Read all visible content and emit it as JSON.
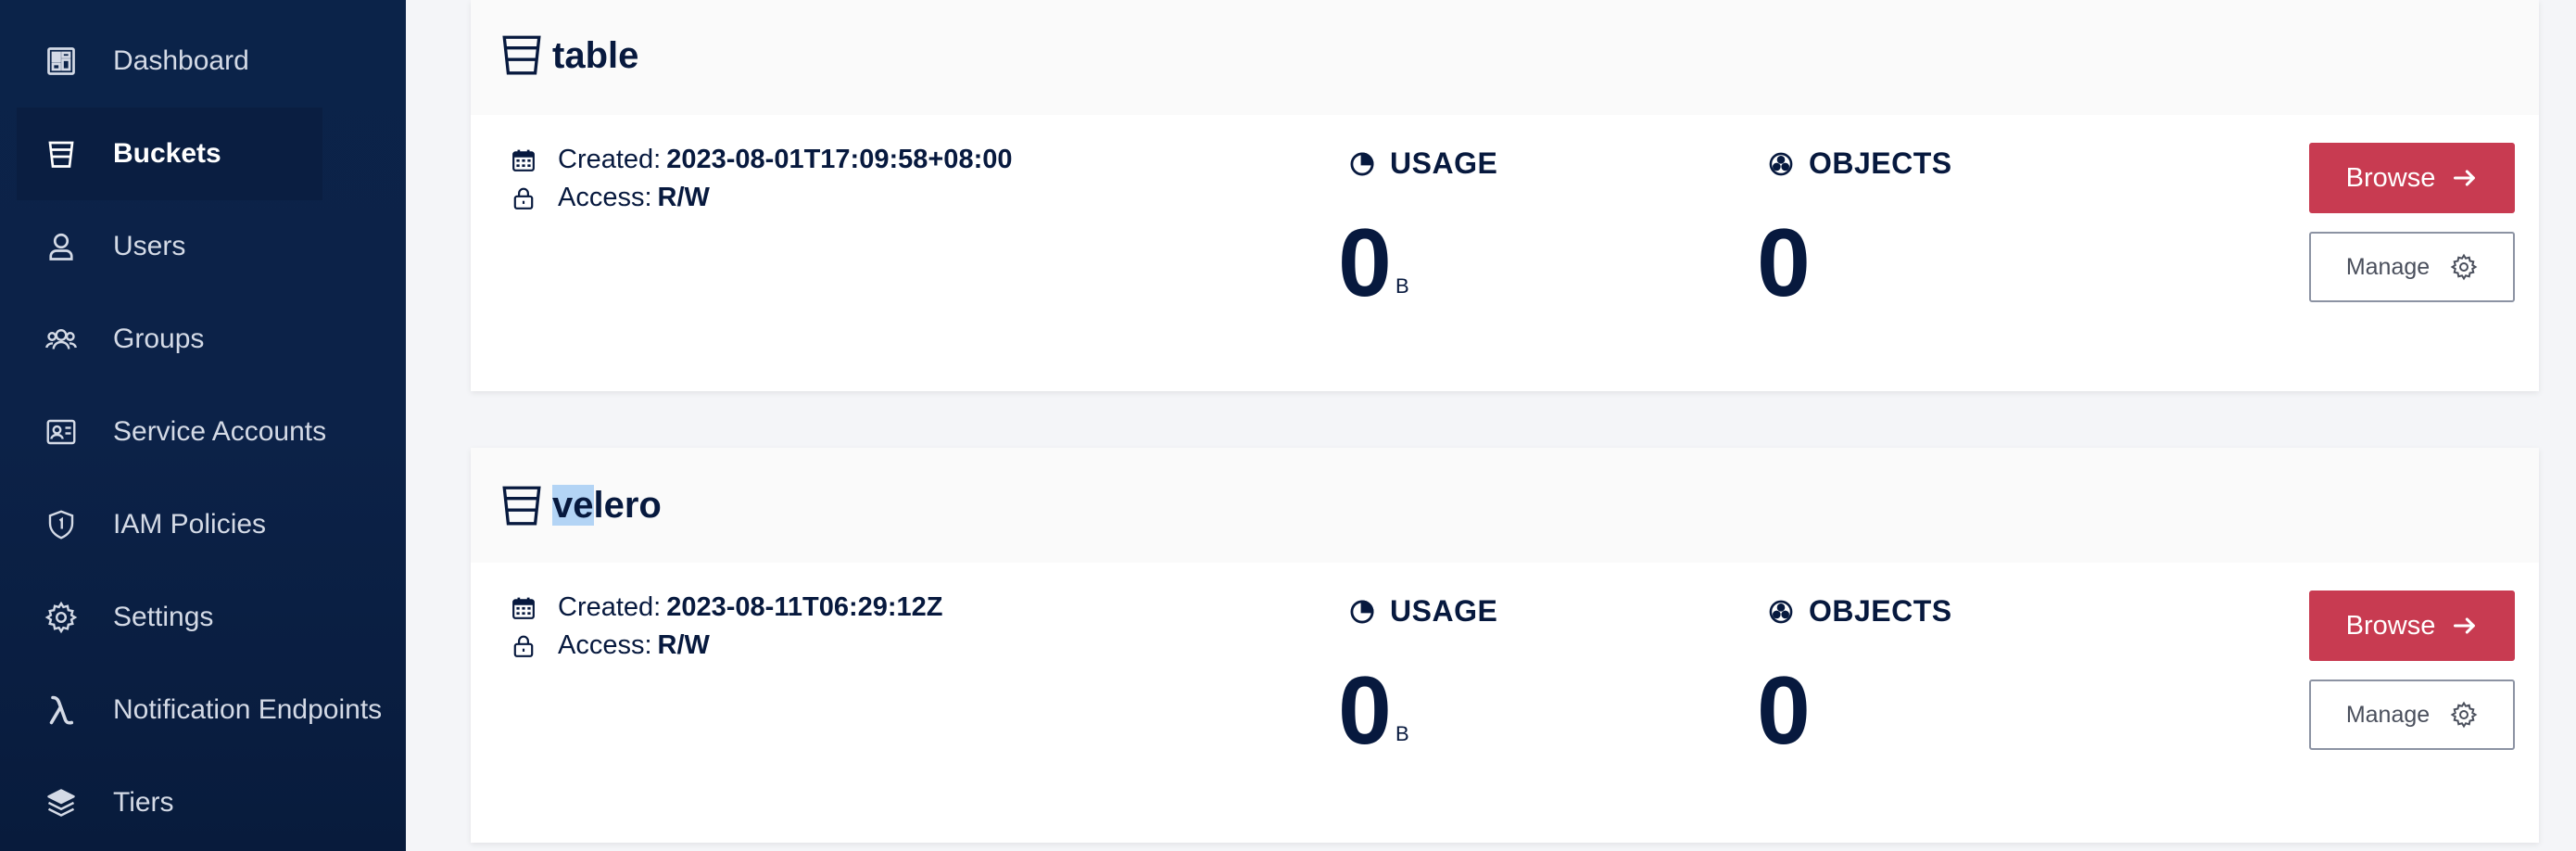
{
  "sidebar": {
    "items": [
      {
        "label": "Dashboard",
        "icon": "dashboard-icon"
      },
      {
        "label": "Buckets",
        "icon": "bucket-icon",
        "active": true
      },
      {
        "label": "Users",
        "icon": "user-icon"
      },
      {
        "label": "Groups",
        "icon": "groups-icon"
      },
      {
        "label": "Service Accounts",
        "icon": "service-account-icon"
      },
      {
        "label": "IAM Policies",
        "icon": "shield-icon"
      },
      {
        "label": "Settings",
        "icon": "gear-icon"
      },
      {
        "label": "Notification Endpoints",
        "icon": "lambda-icon"
      },
      {
        "label": "Tiers",
        "icon": "layers-icon"
      }
    ]
  },
  "buckets": [
    {
      "name": "table",
      "created_label": "Created:",
      "created": "2023-08-01T17:09:58+08:00",
      "access_label": "Access:",
      "access": "R/W",
      "usage_label": "USAGE",
      "usage_value": "0",
      "usage_unit": "B",
      "objects_label": "OBJECTS",
      "objects_value": "0",
      "browse_label": "Browse",
      "manage_label": "Manage"
    },
    {
      "name_selected": "ve",
      "name_rest": "lero",
      "created_label": "Created:",
      "created": "2023-08-11T06:29:12Z",
      "access_label": "Access:",
      "access": "R/W",
      "usage_label": "USAGE",
      "usage_value": "0",
      "usage_unit": "B",
      "objects_label": "OBJECTS",
      "objects_value": "0",
      "browse_label": "Browse",
      "manage_label": "Manage"
    }
  ],
  "colors": {
    "sidebar_bg": "#0c2248",
    "brand_text": "#07193e",
    "browse_button": "#c83b51",
    "selection": "#b3d4f5"
  }
}
